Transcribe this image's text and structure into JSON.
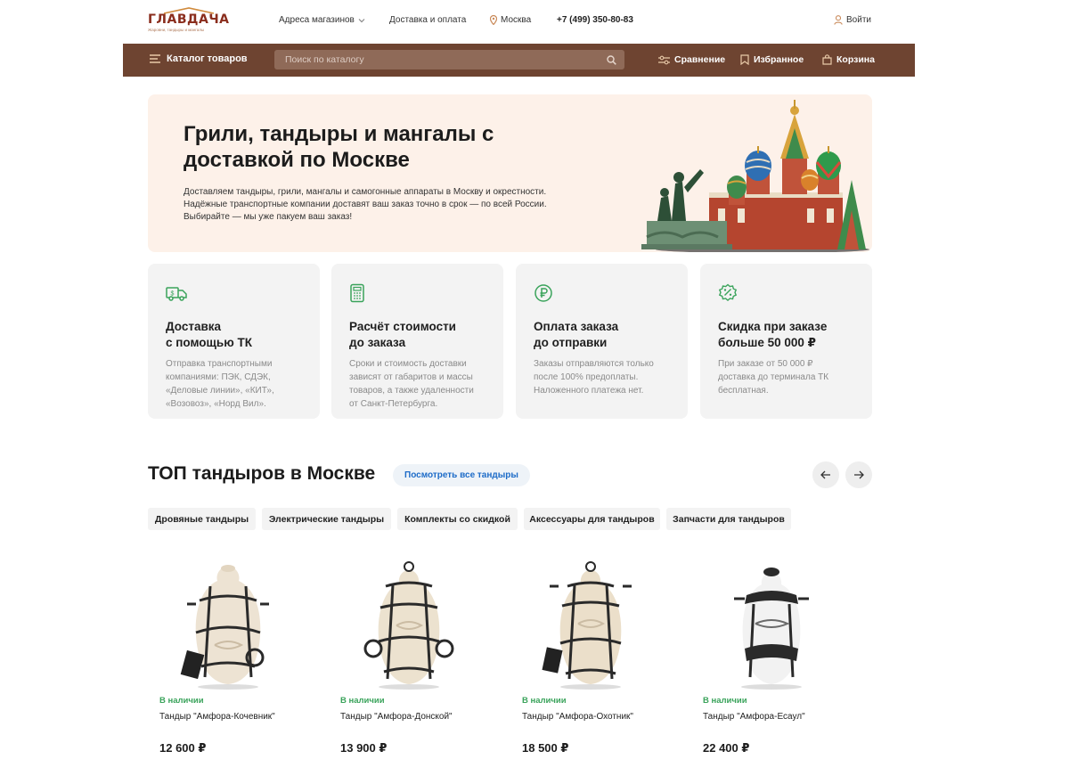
{
  "header": {
    "logo": {
      "name": "ГЛАВДАЧА",
      "tagline": "Жаровни, тандыры и мангалы"
    },
    "stores_label": "Адреса магазинов",
    "delivery_label": "Доставка и оплата",
    "city": "Москва",
    "phone": "+7 (499) 350-80-83",
    "login_label": "Войти"
  },
  "nav": {
    "catalog_label": "Каталог товаров",
    "search_placeholder": "Поиск по каталогу",
    "compare_label": "Сравнение",
    "favorites_label": "Избранное",
    "cart_label": "Корзина"
  },
  "hero": {
    "title": "Грили, тандыры и мангалы с доставкой по Москве",
    "text_lines": [
      "Доставляем тандыры, грили, мангалы и самогонные аппараты в Москву и окрестности.",
      "Надёжные транспортные компании доставят ваш заказ точно в срок — по всей России.",
      "Выбирайте — мы уже пакуем ваш заказ!"
    ]
  },
  "features": [
    {
      "icon": "truck-icon",
      "title_lines": [
        "Доставка",
        "с помощью ТК"
      ],
      "text_lines": [
        "Отправка транспортными",
        "компаниями: ПЭК, СДЭК,",
        "«Деловые линии», «КИТ»,",
        "«Возовоз», «Норд Вил»."
      ]
    },
    {
      "icon": "calculator-icon",
      "title_lines": [
        "Расчёт стоимости",
        "до заказа"
      ],
      "text_lines": [
        "Сроки и стоимость доставки",
        "зависят от габаритов и массы",
        "товаров, а также удаленности",
        "от Санкт-Петербурга."
      ]
    },
    {
      "icon": "ruble-icon",
      "title_lines": [
        "Оплата заказа",
        "до отправки"
      ],
      "text_lines": [
        "Заказы отправляются только",
        "после 100% предоплаты.",
        "Наложенного платежа нет."
      ]
    },
    {
      "icon": "discount-icon",
      "title_lines": [
        "Скидка при заказе",
        "больше 50 000 ₽"
      ],
      "text_lines": [
        "При заказе от 50 000 ₽",
        "доставка до терминала ТК",
        "бесплатная."
      ]
    }
  ],
  "section": {
    "title": "ТОП тандыров в Москве",
    "see_all_label": "Посмотреть все тандыры"
  },
  "filters": [
    "Дровяные тандыры",
    "Электрические тандыры",
    "Комплекты со скидкой",
    "Аксессуары для тандыров",
    "Запчасти для тандыров"
  ],
  "products": [
    {
      "stock": "В наличии",
      "name": "Тандыр \"Амфора-Кочевник\"",
      "price": "12 600 ₽"
    },
    {
      "stock": "В наличии",
      "name": "Тандыр \"Амфора-Донской\"",
      "price": "13 900 ₽"
    },
    {
      "stock": "В наличии",
      "name": "Тандыр \"Амфора-Охотник\"",
      "price": "18 500 ₽"
    },
    {
      "stock": "В наличии",
      "name": "Тандыр \"Амфора-Есаул\"",
      "price": "22 400 ₽"
    }
  ],
  "colors": {
    "brand_brown": "#6e4431",
    "accent_green": "#3aa35b",
    "link_blue": "#1e6cc8",
    "hero_bg": "#fdf1e9"
  }
}
